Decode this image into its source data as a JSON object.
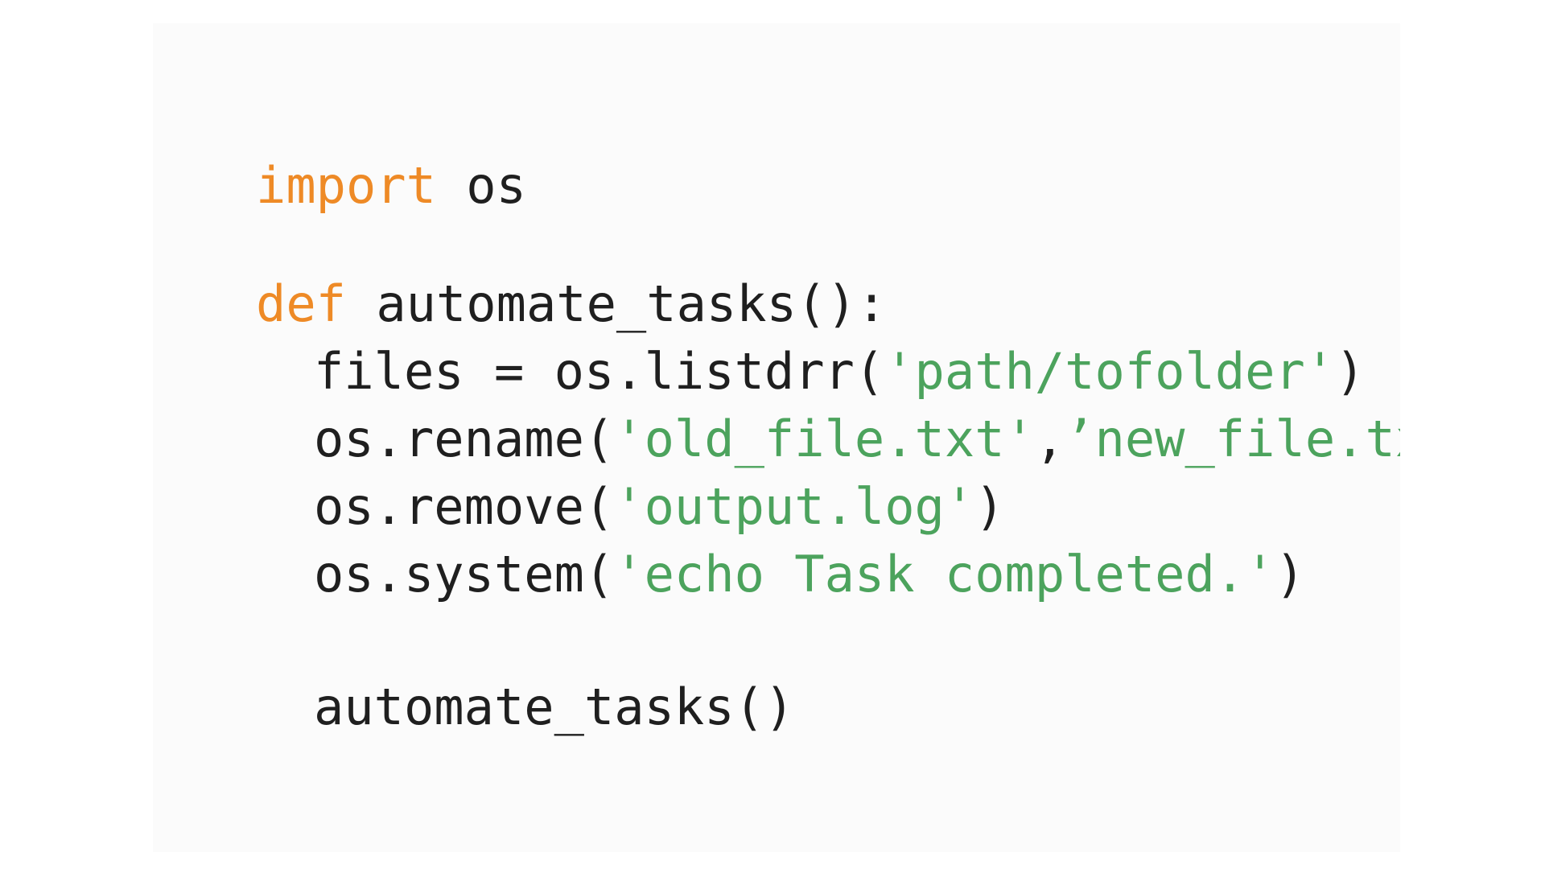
{
  "code": {
    "line1": {
      "keyword": "import",
      "space": " ",
      "module": "os"
    },
    "line2": {
      "keyword": "def",
      "space": " ",
      "signature": "automate_tasks():"
    },
    "line3": {
      "prefix": "files = os.listdrr(",
      "string": "'path/tofolder'",
      "suffix": ")"
    },
    "line4": {
      "prefix": "os.rename(",
      "string1": "'old_file.txt'",
      "comma": ",",
      "string2": "’new_file.txt"
    },
    "line5": {
      "prefix": "os.remove(",
      "string": "'output.log'",
      "suffix": ")"
    },
    "line6": {
      "prefix": "os.system(",
      "string": "'echo Task completed.'",
      "suffix": ")"
    },
    "line7": {
      "call": "automate_tasks()"
    }
  },
  "colors": {
    "background": "#fbfbfb",
    "keyword": "#ee8a26",
    "string": "#4ca35d",
    "text": "#1f1f1f"
  }
}
